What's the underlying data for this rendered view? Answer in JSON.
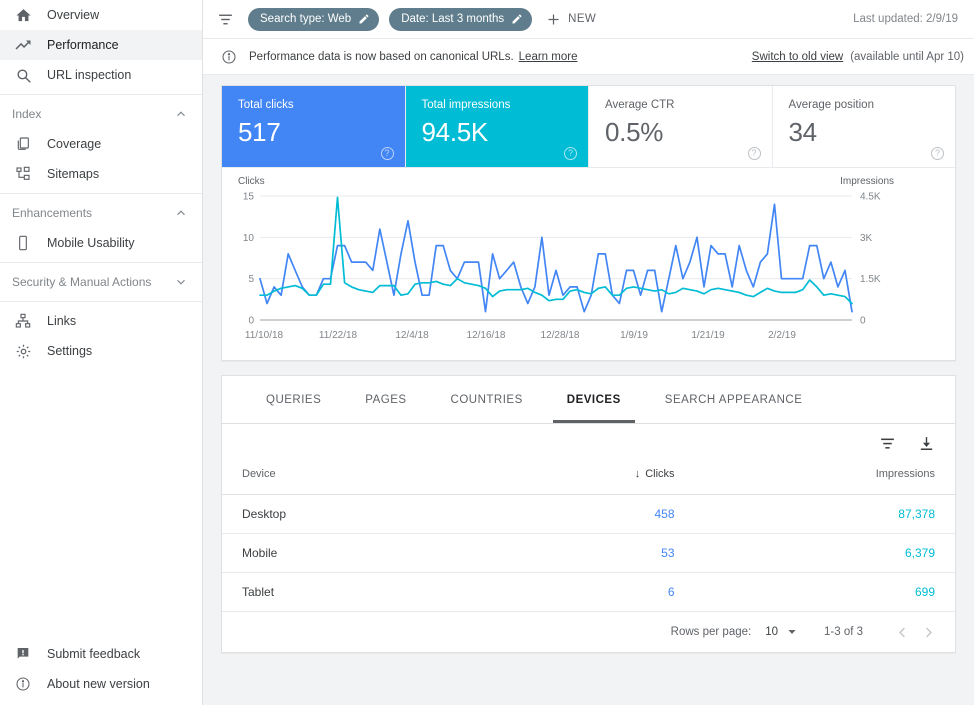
{
  "sidebar": {
    "primary": [
      {
        "label": "Overview",
        "icon": "home-icon",
        "active": false
      },
      {
        "label": "Performance",
        "icon": "trending-up-icon",
        "active": true
      },
      {
        "label": "URL inspection",
        "icon": "search-icon",
        "active": false
      }
    ],
    "index": {
      "title": "Index",
      "expanded": true,
      "items": [
        {
          "label": "Coverage",
          "icon": "documents-icon"
        },
        {
          "label": "Sitemaps",
          "icon": "sitemap-icon"
        }
      ]
    },
    "enhancements": {
      "title": "Enhancements",
      "expanded": true,
      "items": [
        {
          "label": "Mobile Usability",
          "icon": "mobile-icon"
        }
      ]
    },
    "security": {
      "title": "Security & Manual Actions",
      "expanded": false,
      "items": []
    },
    "tools": [
      {
        "label": "Links",
        "icon": "links-icon"
      },
      {
        "label": "Settings",
        "icon": "gear-icon"
      }
    ],
    "footer": [
      {
        "label": "Submit feedback",
        "icon": "feedback-icon"
      },
      {
        "label": "About new version",
        "icon": "info-icon"
      }
    ]
  },
  "toolbar": {
    "filter_icon": "filter-icon",
    "chips": [
      {
        "label": "Search type: Web",
        "edit_icon": "pencil-icon"
      },
      {
        "label": "Date: Last 3 months",
        "edit_icon": "pencil-icon"
      }
    ],
    "new_label": "NEW",
    "last_updated": "Last updated: 2/9/19"
  },
  "banner": {
    "icon": "info-icon",
    "message": "Performance data is now based on canonical URLs.",
    "learn_more": "Learn more",
    "switch_link": "Switch to old view",
    "availability": "(available until Apr 10)"
  },
  "metrics": [
    {
      "label": "Total clicks",
      "value": "517",
      "state": "selected-blue",
      "help_icon": "help-icon"
    },
    {
      "label": "Total impressions",
      "value": "94.5K",
      "state": "selected-cyan",
      "help_icon": "help-icon"
    },
    {
      "label": "Average CTR",
      "value": "0.5%",
      "state": "unselected",
      "help_icon": "help-icon"
    },
    {
      "label": "Average position",
      "value": "34",
      "state": "unselected",
      "help_icon": "help-icon"
    }
  ],
  "chart_data": {
    "type": "line",
    "title": "",
    "left_axis_title": "Clicks",
    "right_axis_title": "Impressions",
    "xlabel": "",
    "grid": true,
    "legend_position": "none",
    "x_tick_labels": [
      "11/10/18",
      "11/22/18",
      "12/4/18",
      "12/16/18",
      "12/28/18",
      "1/9/19",
      "1/21/19",
      "2/2/19"
    ],
    "left_tick_labels": [
      "0",
      "5",
      "10",
      "15"
    ],
    "left_ticks": [
      0,
      5,
      10,
      15
    ],
    "ylim_left": [
      0,
      15
    ],
    "right_tick_labels": [
      "0",
      "1.5K",
      "3K",
      "4.5K"
    ],
    "right_ticks": [
      0,
      1500,
      3000,
      4500
    ],
    "ylim_right": [
      0,
      4500
    ],
    "series": [
      {
        "name": "Clicks",
        "color": "#4285f4",
        "axis": "left",
        "values": [
          5,
          2,
          4,
          3,
          8,
          6,
          4,
          3,
          3,
          5,
          5,
          9,
          9,
          7,
          7,
          7,
          6,
          11,
          7,
          3,
          8,
          12,
          7,
          3,
          3,
          9,
          9,
          6,
          5,
          7,
          7,
          7,
          1,
          8,
          5,
          6,
          7,
          4,
          2,
          4,
          10,
          3,
          6,
          3,
          4,
          4,
          1,
          3,
          8,
          8,
          3,
          2,
          6,
          6,
          3,
          6,
          6,
          1,
          5,
          9,
          5,
          7,
          10,
          4,
          9,
          8,
          8,
          4,
          9,
          6,
          4,
          7,
          8,
          14,
          5,
          5,
          5,
          5,
          9,
          9,
          5,
          7,
          4,
          6,
          1
        ]
      },
      {
        "name": "Impressions",
        "color": "#00bcd4",
        "axis": "right",
        "values": [
          900,
          900,
          1050,
          1150,
          1200,
          1250,
          1150,
          900,
          900,
          1300,
          1300,
          4450,
          1350,
          1200,
          1100,
          1050,
          1000,
          1250,
          1250,
          1250,
          900,
          950,
          1300,
          1350,
          1350,
          1400,
          1300,
          1250,
          1500,
          1350,
          1300,
          1250,
          1150,
          850,
          1050,
          1100,
          1100,
          1100,
          1150,
          1000,
          900,
          700,
          750,
          750,
          1050,
          1100,
          1000,
          950,
          1150,
          1200,
          900,
          900,
          1150,
          1200,
          1150,
          1100,
          1050,
          1100,
          950,
          1000,
          1150,
          1100,
          1050,
          950,
          1100,
          1150,
          1100,
          1050,
          1000,
          900,
          850,
          1000,
          1150,
          1050,
          1000,
          1000,
          1000,
          1100,
          1450,
          1200,
          900,
          950,
          900,
          850,
          600
        ]
      }
    ]
  },
  "table": {
    "tabs": [
      {
        "label": "QUERIES",
        "active": false
      },
      {
        "label": "PAGES",
        "active": false
      },
      {
        "label": "COUNTRIES",
        "active": false
      },
      {
        "label": "DEVICES",
        "active": true
      },
      {
        "label": "SEARCH APPEARANCE",
        "active": false
      }
    ],
    "tools": [
      {
        "name": "filter-icon"
      },
      {
        "name": "download-icon"
      }
    ],
    "columns": [
      {
        "key": "device",
        "label": "Device",
        "align": "left",
        "sorted": false
      },
      {
        "key": "clicks",
        "label": "Clicks",
        "align": "right",
        "sorted": true,
        "sort_dir": "desc"
      },
      {
        "key": "impressions",
        "label": "Impressions",
        "align": "right",
        "sorted": false
      }
    ],
    "rows": [
      {
        "device": "Desktop",
        "clicks": "458",
        "impressions": "87,378"
      },
      {
        "device": "Mobile",
        "clicks": "53",
        "impressions": "6,379"
      },
      {
        "device": "Tablet",
        "clicks": "6",
        "impressions": "699"
      }
    ],
    "pager": {
      "rows_per_page_label": "Rows per page:",
      "rows_per_page_value": "10",
      "range": "1-3 of 3",
      "prev_icon": "chevron-left-icon",
      "next_icon": "chevron-right-icon"
    }
  },
  "colors": {
    "clicks": "#4285f4",
    "impressions": "#00bcd4",
    "chip": "#5f7d8c",
    "active_nav_bg": "#f1f3f4"
  }
}
